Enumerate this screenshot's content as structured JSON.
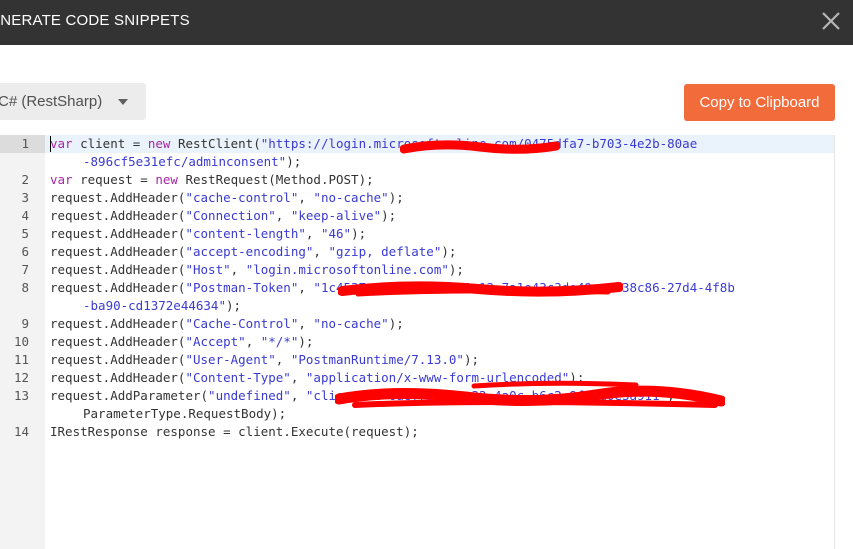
{
  "header": {
    "title": "ENERATE CODE SNIPPETS",
    "close_icon": "close-icon"
  },
  "toolbar": {
    "language_value": "C# (RestSharp)",
    "dropdown_icon": "chevron-down-icon",
    "copy_label": "Copy to Clipboard"
  },
  "colors": {
    "accent": "#f26b3a",
    "titlebar": "#333333",
    "keyword": "#a626a4",
    "string": "#3a3ad0",
    "redaction": "#ff0000"
  },
  "editor": {
    "line_numbers": [
      "1",
      "2",
      "3",
      "4",
      "5",
      "6",
      "7",
      "8",
      "9",
      "10",
      "11",
      "12",
      "13",
      "14"
    ],
    "lines": {
      "l1": {
        "kw": "var",
        "a": " client = ",
        "kw2": "new",
        "b": " RestClient(",
        "s": "\"https://login.microsoftonline.com/0475dfa7-b703-4e2b-80ae",
        "s2": "-896cf5e31efc/adminconsent\"",
        "c": ");"
      },
      "l2": {
        "kw": "var",
        "a": " request = ",
        "kw2": "new",
        "b": " RestRequest(Method.POST);"
      },
      "l3": {
        "a": "request.AddHeader(",
        "s": "\"cache-control\"",
        "b": ", ",
        "s2": "\"no-cache\"",
        "c": ");"
      },
      "l4": {
        "a": "request.AddHeader(",
        "s": "\"Connection\"",
        "b": ", ",
        "s2": "\"keep-alive\"",
        "c": ");"
      },
      "l5": {
        "a": "request.AddHeader(",
        "s": "\"content-length\"",
        "b": ", ",
        "s2": "\"46\"",
        "c": ");"
      },
      "l6": {
        "a": "request.AddHeader(",
        "s": "\"accept-encoding\"",
        "b": ", ",
        "s2": "\"gzip, deflate\"",
        "c": ");"
      },
      "l7": {
        "a": "request.AddHeader(",
        "s": "\"Host\"",
        "b": ", ",
        "s2": "\"login.microsoftonline.com\"",
        "c": ");"
      },
      "l8": {
        "a": "request.AddHeader(",
        "s": "\"Postman-Token\"",
        "b": ", ",
        "s2": "\"1c4537c4-b8e0-4909-9a13-7a1e43c3de49,eeb38c86-27d4-4f8b",
        "s3": "-ba90-cd1372e44634\"",
        "c": ");"
      },
      "l9": {
        "a": "request.AddHeader(",
        "s": "\"Cache-Control\"",
        "b": ", ",
        "s2": "\"no-cache\"",
        "c": ");"
      },
      "l10": {
        "a": "request.AddHeader(",
        "s": "\"Accept\"",
        "b": ", ",
        "s2": "\"*/*\"",
        "c": ");"
      },
      "l11": {
        "a": "request.AddHeader(",
        "s": "\"User-Agent\"",
        "b": ", ",
        "s2": "\"PostmanRuntime/7.13.0\"",
        "c": ");"
      },
      "l12": {
        "a": "request.AddHeader(",
        "s": "\"Content-Type\"",
        "b": ", ",
        "s2": "\"application/x-www-form-urlencoded\"",
        "c": ");"
      },
      "l13": {
        "a": "request.AddParameter(",
        "s": "\"undefined\"",
        "b": ", ",
        "s2": "\"client_id=6aef7b40-1c32-4a0c-b6c2-8f75d0e3a911\"",
        "c": ",",
        "w": "ParameterType.RequestBody);"
      },
      "l14": {
        "a": "IRestResponse response = client.Execute(request);"
      }
    }
  }
}
